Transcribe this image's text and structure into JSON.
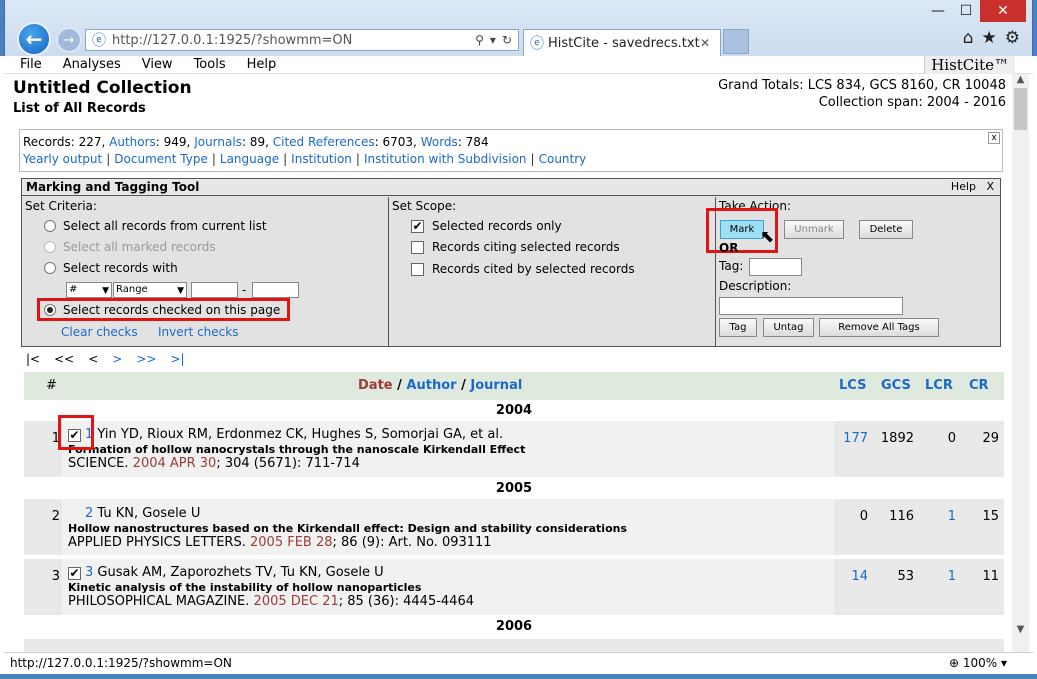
{
  "browser": {
    "address": "http://127.0.0.1:1925/?showmm=ON",
    "tab_title": "HistCite - savedrecs.txt",
    "tab_close": "✕",
    "brand": "HistCite™",
    "icons": [
      "back-icon",
      "forward-icon",
      "search-icon",
      "refresh-icon",
      "home-icon",
      "star-icon",
      "gear-icon"
    ]
  },
  "menu": [
    "File",
    "Analyses",
    "View",
    "Tools",
    "Help"
  ],
  "header": {
    "title": "Untitled Collection",
    "subtitle": "List of All Records",
    "grand_totals": "Grand Totals: LCS 834, GCS 8160, CR 10048",
    "span": "Collection span: 2004 - 2016"
  },
  "summary": {
    "records_label": "Records: 227,",
    "authors": "Authors",
    "authors_val": ": 949,",
    "journals": "Journals",
    "journals_val": ": 89,",
    "cited": "Cited References",
    "cited_val": ": 6703,",
    "words": "Words",
    "words_val": ": 784",
    "links": [
      "Yearly output",
      "Document Type",
      "Language",
      "Institution",
      "Institution with Subdivision",
      "Country"
    ],
    "close": "x"
  },
  "tool": {
    "title": "Marking and Tagging Tool",
    "help": "Help",
    "close": "X",
    "criteria_label": "Set Criteria:",
    "criteria": [
      "Select all records from current list",
      "Select all marked records",
      "Select records with",
      "Select records checked on this page"
    ],
    "field_select": "#",
    "range_select": "Range",
    "dash": "-",
    "clear_checks": "Clear checks",
    "invert_checks": "Invert checks",
    "scope_label": "Set Scope:",
    "scope": [
      "Selected records only",
      "Records citing selected records",
      "Records cited by selected records"
    ],
    "action_label": "Take Action:",
    "mark": "Mark",
    "unmark": "Unmark",
    "delete": "Delete",
    "or": "OR",
    "tag_label": "Tag:",
    "desc_label": "Description:",
    "tag_btn": "Tag",
    "untag_btn": "Untag",
    "remove_all": "Remove All Tags"
  },
  "pager": [
    "|<",
    "<<",
    "<",
    ">",
    ">>",
    ">|"
  ],
  "table": {
    "headers": {
      "num": "#",
      "date": "Date",
      "slash1": " / ",
      "author": "Author",
      "slash2": " / ",
      "journal": "Journal",
      "lcs": "LCS",
      "gcs": "GCS",
      "lcr": "LCR",
      "cr": "CR"
    },
    "rows": [
      {
        "year": "2004",
        "num": "1",
        "idx": "1",
        "authors": "Yin YD, Rioux RM, Erdonmez CK, Hughes S, Somorjai GA, et al.",
        "title": "Formation of hollow nanocrystals through the nanoscale Kirkendall Effect",
        "journal": "SCIENCE.",
        "date": "2004 APR 30",
        "ref": "; 304 (5671): 711-714",
        "lcs": "177",
        "gcs": "1892",
        "lcr": "0",
        "cr": "29",
        "checked": true
      },
      {
        "year": "2005",
        "num": "2",
        "idx": "2",
        "authors": "Tu KN, Gosele U",
        "title": "Hollow nanostructures based on the Kirkendall effect: Design and stability considerations",
        "journal": "APPLIED PHYSICS LETTERS.",
        "date": "2005 FEB 28",
        "ref": "; 86 (9): Art. No. 093111",
        "lcs": "0",
        "gcs": "116",
        "lcr": "1",
        "cr": "15",
        "checked": false
      },
      {
        "year": "",
        "num": "3",
        "idx": "3",
        "authors": "Gusak AM, Zaporozhets TV, Tu KN, Gosele U",
        "title": "Kinetic analysis of the instability of hollow nanoparticles",
        "journal": "PHILOSOPHICAL MAGAZINE.",
        "date": "2005 DEC 21",
        "ref": "; 85 (36): 4445-4464",
        "lcs": "14",
        "gcs": "53",
        "lcr": "1",
        "cr": "11",
        "checked": true
      }
    ],
    "year_2006": "2006"
  },
  "status": {
    "url": "http://127.0.0.1:1925/?showmm=ON",
    "zoom": "100%"
  }
}
